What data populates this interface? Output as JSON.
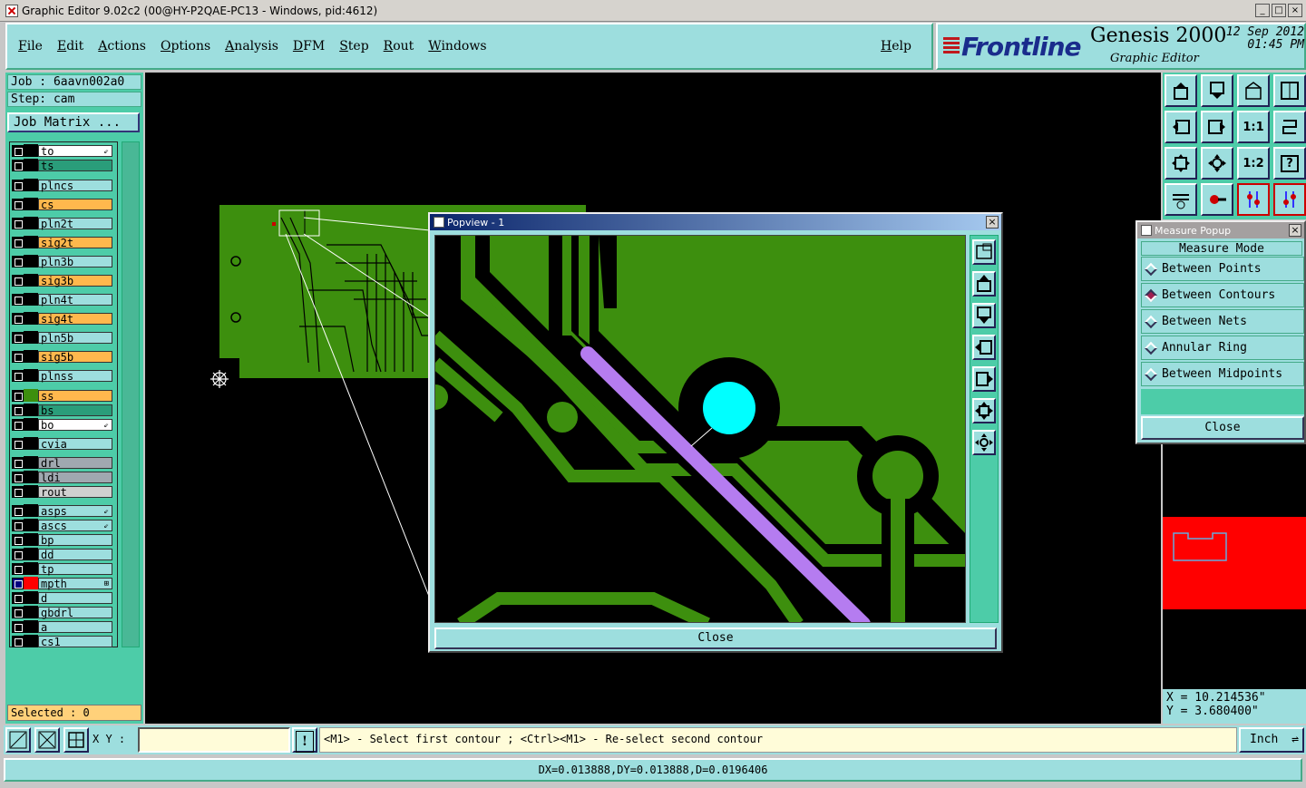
{
  "window": {
    "title": "Graphic Editor 9.02c2 (00@HY-P2QAE-PC13 - Windows, pid:4612)",
    "min": "_",
    "max": "□",
    "close": "×"
  },
  "menu": {
    "items": [
      "File",
      "Edit",
      "Actions",
      "Options",
      "Analysis",
      "DFM",
      "Step",
      "Rout",
      "Windows"
    ],
    "help": "Help"
  },
  "brand": {
    "logo": "Frontline",
    "product": "Genesis 2000",
    "subtitle": "Graphic Editor",
    "date": "12 Sep 2012",
    "time": "01:45 PM"
  },
  "job": {
    "job_line": "Job : 6aavn002a0",
    "step_line": "Step: cam",
    "matrix_button": "Job Matrix ..."
  },
  "layers": [
    {
      "name": "to",
      "color": "#ffffff",
      "flag": "⇙"
    },
    {
      "name": "ts",
      "color": "#2a9d7a",
      "flag": ""
    },
    {
      "name": "plncs",
      "color": "#9ddede",
      "flag": ""
    },
    {
      "name": "cs",
      "color": "#ffb84d",
      "flag": ""
    },
    {
      "name": "pln2t",
      "color": "#9ddede",
      "flag": ""
    },
    {
      "name": "sig2t",
      "color": "#ffb84d",
      "flag": ""
    },
    {
      "name": "pln3b",
      "color": "#9ddede",
      "flag": ""
    },
    {
      "name": "sig3b",
      "color": "#ffb84d",
      "flag": ""
    },
    {
      "name": "pln4t",
      "color": "#9ddede",
      "flag": ""
    },
    {
      "name": "sig4t",
      "color": "#ffb84d",
      "flag": ""
    },
    {
      "name": "pln5b",
      "color": "#9ddede",
      "flag": ""
    },
    {
      "name": "sig5b",
      "color": "#ffb84d",
      "flag": ""
    },
    {
      "name": "plnss",
      "color": "#9ddede",
      "flag": ""
    },
    {
      "name": "ss",
      "color": "#ffb84d",
      "flag": ""
    },
    {
      "name": "bs",
      "color": "#2a9d7a",
      "flag": ""
    },
    {
      "name": "bo",
      "color": "#ffffff",
      "flag": "⇙"
    },
    {
      "name": "cvia",
      "color": "#9ddede",
      "flag": ""
    },
    {
      "name": "drl",
      "color": "#a0a8b0",
      "flag": ""
    },
    {
      "name": "ldi",
      "color": "#a0a8b0",
      "flag": ""
    },
    {
      "name": "rout",
      "color": "#d0d0d0",
      "flag": ""
    },
    {
      "name": "asps",
      "color": "#9ddede",
      "flag": "⇙"
    },
    {
      "name": "ascs",
      "color": "#9ddede",
      "flag": "⇙"
    },
    {
      "name": "bp",
      "color": "#9ddede",
      "flag": ""
    },
    {
      "name": "dd",
      "color": "#9ddede",
      "flag": ""
    },
    {
      "name": "tp",
      "color": "#9ddede",
      "flag": ""
    },
    {
      "name": "mpth",
      "color": "#9ddede",
      "flag": "⊞"
    },
    {
      "name": "d",
      "color": "#9ddede",
      "flag": ""
    },
    {
      "name": "gbdrl",
      "color": "#9ddede",
      "flag": ""
    },
    {
      "name": "a",
      "color": "#9ddede",
      "flag": ""
    },
    {
      "name": "cs1",
      "color": "#9ddede",
      "flag": ""
    }
  ],
  "selected": "Selected : 0",
  "popview": {
    "title": "Popview - 1",
    "close": "Close"
  },
  "measure": {
    "title": "Measure Popup",
    "header": "Measure Mode",
    "options": [
      {
        "label": "Between Points",
        "selected": false
      },
      {
        "label": "Between Contours",
        "selected": true
      },
      {
        "label": "Between Nets",
        "selected": false
      },
      {
        "label": "Annular Ring",
        "selected": false
      },
      {
        "label": "Between Midpoints",
        "selected": false
      }
    ],
    "close": "Close"
  },
  "toolbar_icons": [
    "zoom-home-icon",
    "zoom-fit-icon",
    "zoom-home2-icon",
    "zoom-window-icon",
    "pan-left-icon",
    "pan-right-icon",
    "one-to-one-icon",
    "redraw-icon",
    "fit-screen-icon",
    "center-icon",
    "scale-1-2-icon",
    "help-icon",
    "pen-tool-icon",
    "probe-icon",
    "net-highlight-icon",
    "net-compare-icon"
  ],
  "toolbar_labels": {
    "one_to_one": "1:1",
    "half": "1:2",
    "help": "?"
  },
  "coords": {
    "x": "X = 10.214536\"",
    "y": "Y = 3.680400\""
  },
  "bottom": {
    "xy_label": "X Y :",
    "xy_value": "",
    "prompt": "<M1> - Select first contour ; <Ctrl><M1> - Re-select second contour",
    "units": "Inch",
    "warn": "!"
  },
  "status": "DX=0.013888,DY=0.013888,D=0.0196406",
  "colors": {
    "board_green": "#3d8f0e",
    "highlight_purple": "#b57cf0",
    "pad_cyan": "#00ffff",
    "ui_teal": "#9ddede",
    "ui_dark_teal": "#4dcca8",
    "overview_red": "#ff0000"
  }
}
